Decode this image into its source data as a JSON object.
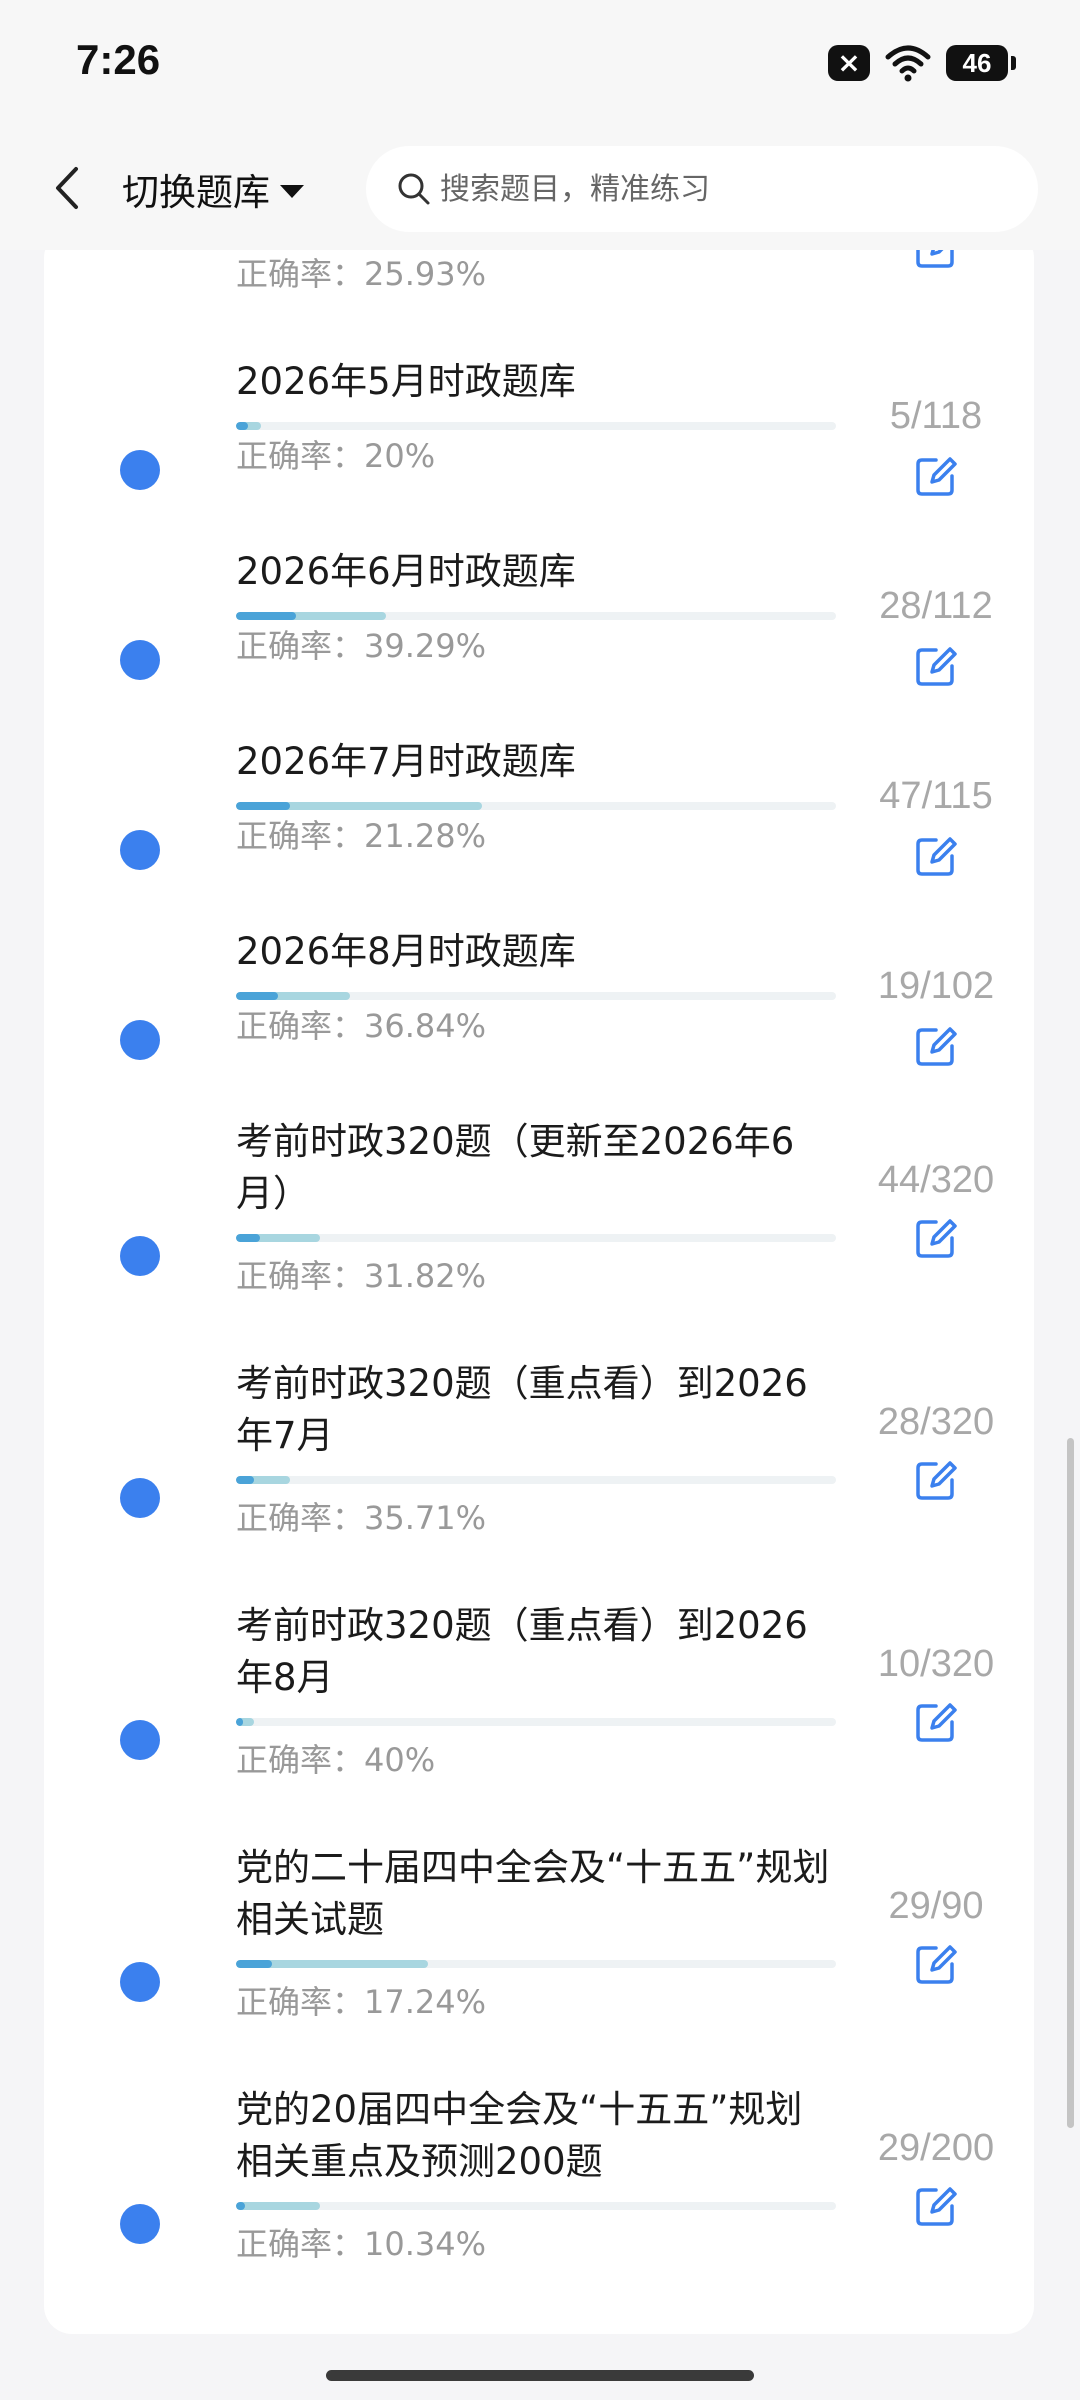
{
  "status": {
    "time": "7:26",
    "battery": "46",
    "sim_mark": "×"
  },
  "header": {
    "switch_label": "切换题库",
    "search_placeholder": "搜索题目，精准练习"
  },
  "items": [
    {
      "title": "",
      "accuracy": "正确率：25.93%",
      "count": "",
      "progress_answered": 0.0,
      "progress_correct": 0.0
    },
    {
      "title": "2026年5月时政题库",
      "accuracy": "正确率：20%",
      "count": "5/118",
      "progress_answered": 0.042,
      "progress_correct": 0.02
    },
    {
      "title": "2026年6月时政题库",
      "accuracy": "正确率：39.29%",
      "count": "28/112",
      "progress_answered": 0.25,
      "progress_correct": 0.1
    },
    {
      "title": "2026年7月时政题库",
      "accuracy": "正确率：21.28%",
      "count": "47/115",
      "progress_answered": 0.41,
      "progress_correct": 0.09
    },
    {
      "title": "2026年8月时政题库",
      "accuracy": "正确率：36.84%",
      "count": "19/102",
      "progress_answered": 0.19,
      "progress_correct": 0.07
    },
    {
      "title": "考前时政320题（更新至2026年6月）",
      "accuracy": "正确率：31.82%",
      "count": "44/320",
      "progress_answered": 0.14,
      "progress_correct": 0.04
    },
    {
      "title": "考前时政320题（重点看）到2026年7月",
      "accuracy": "正确率：35.71%",
      "count": "28/320",
      "progress_answered": 0.09,
      "progress_correct": 0.03
    },
    {
      "title": "考前时政320题（重点看）到2026年8月",
      "accuracy": "正确率：40%",
      "count": "10/320",
      "progress_answered": 0.03,
      "progress_correct": 0.012
    },
    {
      "title": "党的二十届四中全会及“十五五”规划相关试题",
      "accuracy": "正确率：17.24%",
      "count": "29/90",
      "progress_answered": 0.32,
      "progress_correct": 0.06
    },
    {
      "title": "党的20届四中全会及“十五五”规划相关重点及预测200题",
      "accuracy": "正确率：10.34%",
      "count": "29/200",
      "progress_answered": 0.14,
      "progress_correct": 0.015
    }
  ]
}
